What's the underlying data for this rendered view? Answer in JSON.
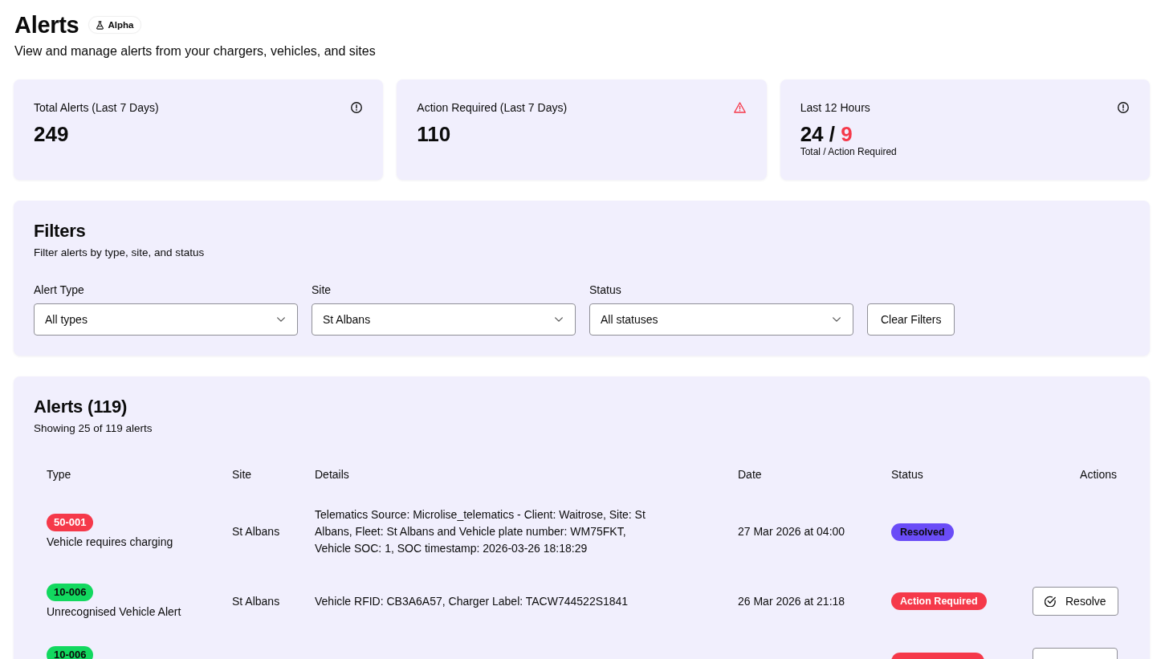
{
  "header": {
    "title": "Alerts",
    "tag": "Alpha",
    "subtitle": "View and manage alerts from your chargers, vehicles, and sites"
  },
  "stats": [
    {
      "kind": "info",
      "label": "Total Alerts (Last 7 Days)",
      "value": "249"
    },
    {
      "kind": "warning",
      "label": "Action Required (Last 7 Days)",
      "value": "110"
    },
    {
      "kind": "info",
      "label": "Last 12 Hours",
      "value": "24 /",
      "alert_value": "9",
      "caption": "Total / Action Required"
    }
  ],
  "filters": {
    "title": "Filters",
    "subtitle": "Filter alerts by type, site, and status",
    "fields": [
      {
        "label": "Alert Type",
        "value": "All types"
      },
      {
        "label": "Site",
        "value": "St Albans"
      },
      {
        "label": "Status",
        "value": "All statuses"
      }
    ],
    "clear_button": "Clear Filters"
  },
  "alerts": {
    "title": "Alerts (119)",
    "subtitle": "Showing 25 of 119 alerts",
    "columns": [
      "Type",
      "Site",
      "Details",
      "Date",
      "Status",
      "Actions"
    ],
    "rows": [
      {
        "code": "50-001",
        "color": "#f5394a",
        "name": "Vehicle requires charging",
        "site": "St Albans",
        "details": "Telematics Source: Microlise_telematics - Client: Waitrose, Site: St Albans, Fleet: St Albans and Vehicle plate number: WM75FKT, Vehicle SOC: 1, SOC timestamp: 2026-03-26 18:18:29",
        "date": "27 Mar 2026 at 04:00",
        "status": {
          "kind": "resolved",
          "label": "Resolved"
        }
      },
      {
        "code": "10-006",
        "color": "#12d85f",
        "name": "Unrecognised Vehicle Alert",
        "site": "St Albans",
        "details": "Vehicle RFID: CB3A6A57, Charger Label: TACW744522S1841",
        "date": "26 Mar 2026 at 21:18",
        "status": {
          "kind": "action_required",
          "label": "Action Required"
        },
        "action": {
          "kind": "resolve",
          "label": "Resolve"
        }
      },
      {
        "code": "10-006",
        "color": "#12d85f",
        "status": {
          "kind": "action_required"
        },
        "action": {
          "kind": "resolve"
        }
      }
    ]
  }
}
